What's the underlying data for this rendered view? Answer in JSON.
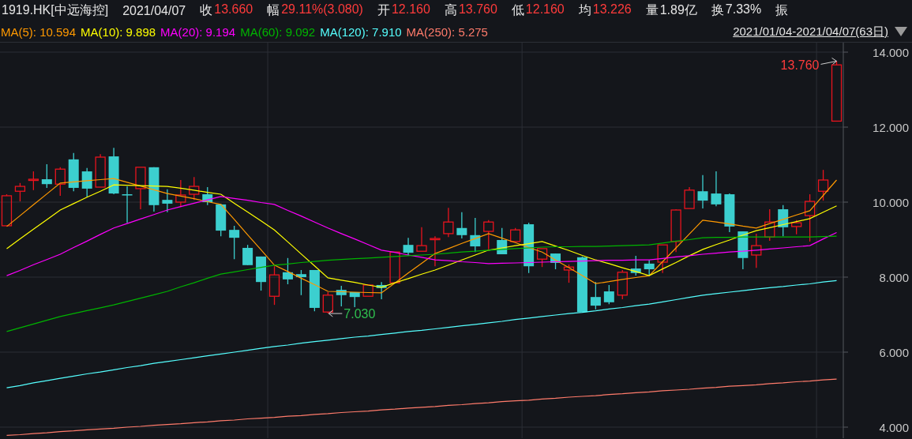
{
  "header": {
    "symbol": "1919.HK[中远海控]",
    "date": "2021/04/07",
    "quotes": [
      {
        "label": "收",
        "value": "13.660",
        "color": "#ff3b3b"
      },
      {
        "label": "幅",
        "value": "29.11%(3.080)",
        "color": "#ff3b3b"
      },
      {
        "label": "开",
        "value": "12.160",
        "color": "#ff3b3b"
      },
      {
        "label": "高",
        "value": "13.760",
        "color": "#ff3b3b"
      },
      {
        "label": "低",
        "value": "12.160",
        "color": "#ff3b3b"
      },
      {
        "label": "均",
        "value": "13.226",
        "color": "#ff3b3b"
      },
      {
        "label": "量",
        "value": "1.89亿",
        "color": "#e6e6e6"
      },
      {
        "label": "换",
        "value": "7.33%",
        "color": "#e6e6e6"
      },
      {
        "label": "振"
      }
    ]
  },
  "legend": {
    "values": [
      ": 10.594",
      ": 9.898",
      ": 9.194",
      ": 9.092",
      ": 7.910",
      ": 5.275"
    ],
    "range": "2021/01/04-2021/04/07(63日)"
  },
  "chart": {
    "high_label": "13.760",
    "low_label": "7.030",
    "chart_data": {
      "type": "candlestick",
      "ylim": [
        3.705,
        14.253
      ],
      "grid": true,
      "yticks": [
        {
          "value": 14,
          "label": "14.000"
        },
        {
          "value": 12,
          "label": "12.000"
        },
        {
          "value": 10,
          "label": "10.000"
        },
        {
          "value": 8,
          "label": "8.000"
        },
        {
          "value": 6,
          "label": "6.000"
        },
        {
          "value": 4,
          "label": "4.000"
        }
      ],
      "categories": [
        null,
        null,
        null,
        null,
        null,
        null,
        null,
        null,
        null,
        null,
        null,
        null,
        null,
        null,
        null,
        null,
        null,
        null,
        null,
        null,
        null,
        null,
        null,
        null,
        null,
        null,
        null,
        null,
        null,
        null,
        null,
        null,
        null,
        null,
        null,
        null,
        null,
        null,
        null,
        null,
        null,
        null,
        null,
        null,
        null,
        null,
        null,
        null,
        null,
        null,
        null,
        null,
        null,
        null,
        null,
        null,
        null,
        null,
        null,
        null,
        null,
        null,
        null
      ],
      "ohlc": [
        [
          9.37,
          10.21,
          9.37,
          10.17
        ],
        [
          10.29,
          10.51,
          10.02,
          10.42
        ],
        [
          10.59,
          10.82,
          10.32,
          10.61
        ],
        [
          10.61,
          11.01,
          10.38,
          10.48
        ],
        [
          10.48,
          10.93,
          10.17,
          10.88
        ],
        [
          11.14,
          11.31,
          10.29,
          10.38
        ],
        [
          10.82,
          10.91,
          10.13,
          10.36
        ],
        [
          10.4,
          11.28,
          10.4,
          11.2
        ],
        [
          11.22,
          11.45,
          10.21,
          10.23
        ],
        [
          10.21,
          10.42,
          9.45,
          10.19
        ],
        [
          10.36,
          10.93,
          9.81,
          10.93
        ],
        [
          10.93,
          10.93,
          9.75,
          9.92
        ],
        [
          10.06,
          10.34,
          9.73,
          9.96
        ],
        [
          10.0,
          10.59,
          9.87,
          10.19
        ],
        [
          10.21,
          10.67,
          10.06,
          10.42
        ],
        [
          10.21,
          10.4,
          9.92,
          10.0
        ],
        [
          9.94,
          9.96,
          9.09,
          9.24
        ],
        [
          9.26,
          9.37,
          8.48,
          9.05
        ],
        [
          8.78,
          8.86,
          8.32,
          8.32
        ],
        [
          8.55,
          8.55,
          7.64,
          7.87
        ],
        [
          7.49,
          8.29,
          7.26,
          8.06
        ],
        [
          8.13,
          8.51,
          7.81,
          7.94
        ],
        [
          8.08,
          8.19,
          7.52,
          8.0
        ],
        [
          8.19,
          8.19,
          7.09,
          7.18
        ],
        [
          7.07,
          7.6,
          7.03,
          7.52
        ],
        [
          7.66,
          7.77,
          7.22,
          7.52
        ],
        [
          7.6,
          7.6,
          7.2,
          7.47
        ],
        [
          7.49,
          7.81,
          7.49,
          7.79
        ],
        [
          7.79,
          7.87,
          7.41,
          7.71
        ],
        [
          7.85,
          8.67,
          7.85,
          8.67
        ],
        [
          8.86,
          9.05,
          8.57,
          8.65
        ],
        [
          8.69,
          9.33,
          8.69,
          8.84
        ],
        [
          9.01,
          9.09,
          8.29,
          9.03
        ],
        [
          9.16,
          9.85,
          9.07,
          9.47
        ],
        [
          9.31,
          9.73,
          9.03,
          9.12
        ],
        [
          9.12,
          9.58,
          8.67,
          8.82
        ],
        [
          9.22,
          9.52,
          8.74,
          9.47
        ],
        [
          8.99,
          9.31,
          8.61,
          8.61
        ],
        [
          8.95,
          9.31,
          8.95,
          9.26
        ],
        [
          9.41,
          9.45,
          8.11,
          8.29
        ],
        [
          8.48,
          8.76,
          8.27,
          8.76
        ],
        [
          8.63,
          8.63,
          8.21,
          8.38
        ],
        [
          8.19,
          8.34,
          7.85,
          8.27
        ],
        [
          8.53,
          8.55,
          7.07,
          7.07
        ],
        [
          7.47,
          7.87,
          7.14,
          7.24
        ],
        [
          7.62,
          7.79,
          7.28,
          7.33
        ],
        [
          7.52,
          8.19,
          7.41,
          8.13
        ],
        [
          8.23,
          8.57,
          8.04,
          8.11
        ],
        [
          8.36,
          8.46,
          8.06,
          8.21
        ],
        [
          8.4,
          8.86,
          8.11,
          8.86
        ],
        [
          8.95,
          9.81,
          8.67,
          9.79
        ],
        [
          9.83,
          10.4,
          9.83,
          10.32
        ],
        [
          10.29,
          10.72,
          9.83,
          10.04
        ],
        [
          10.23,
          10.82,
          9.89,
          9.94
        ],
        [
          10.21,
          10.23,
          9.2,
          9.35
        ],
        [
          9.22,
          9.22,
          8.21,
          8.51
        ],
        [
          8.59,
          9.16,
          8.25,
          8.84
        ],
        [
          9.07,
          9.81,
          8.97,
          9.47
        ],
        [
          9.81,
          9.92,
          9.09,
          9.33
        ],
        [
          9.35,
          9.52,
          9.14,
          9.45
        ],
        [
          9.64,
          10.21,
          8.95,
          10.02
        ],
        [
          10.29,
          10.86,
          10.04,
          10.59
        ],
        [
          12.16,
          13.76,
          12.16,
          13.66
        ]
      ],
      "series": [
        {
          "name": "MA(5)",
          "type": "line",
          "color": "#ff9900",
          "values": [
            9.35,
            9.64,
            9.93,
            10.22,
            10.51,
            10.54,
            10.57,
            10.6,
            10.63,
            10.53,
            10.43,
            10.33,
            10.23,
            10.16,
            10.09,
            10.01,
            9.94,
            9.54,
            9.13,
            8.73,
            8.32,
            8.15,
            7.97,
            7.8,
            7.62,
            7.61,
            7.6,
            7.59,
            7.58,
            7.84,
            8.11,
            8.37,
            8.63,
            8.76,
            8.9,
            9.03,
            9.16,
            9.04,
            8.92,
            8.79,
            8.67,
            8.46,
            8.25,
            8.04,
            7.83,
            7.88,
            7.94,
            7.99,
            8.04,
            8.41,
            8.78,
            9.15,
            9.52,
            9.47,
            9.42,
            9.36,
            9.31,
            9.43,
            9.54,
            9.66,
            9.77,
            10.18,
            10.59
          ]
        },
        {
          "name": "MA(10)",
          "type": "line",
          "color": "#ffff00",
          "values": [
            8.76,
            9.02,
            9.28,
            9.53,
            9.79,
            9.96,
            10.13,
            10.29,
            10.46,
            10.45,
            10.44,
            10.43,
            10.42,
            10.37,
            10.32,
            10.26,
            10.21,
            9.97,
            9.74,
            9.5,
            9.26,
            8.94,
            8.62,
            8.3,
            7.98,
            7.92,
            7.86,
            7.79,
            7.73,
            7.85,
            7.96,
            8.08,
            8.19,
            8.32,
            8.46,
            8.59,
            8.72,
            8.78,
            8.84,
            8.89,
            8.95,
            8.83,
            8.71,
            8.58,
            8.46,
            8.36,
            8.25,
            8.15,
            8.04,
            8.22,
            8.39,
            8.57,
            8.74,
            8.87,
            8.99,
            9.12,
            9.24,
            9.32,
            9.4,
            9.48,
            9.56,
            9.73,
            9.9
          ]
        },
        {
          "name": "MA(20)",
          "type": "line",
          "color": "#ff00ff",
          "values": [
            8.04,
            8.18,
            8.33,
            8.47,
            8.61,
            8.79,
            8.96,
            9.14,
            9.31,
            9.43,
            9.55,
            9.67,
            9.79,
            9.88,
            9.97,
            10.06,
            10.15,
            10.1,
            10.05,
            9.99,
            9.94,
            9.78,
            9.63,
            9.47,
            9.31,
            9.16,
            9.02,
            8.87,
            8.72,
            8.66,
            8.59,
            8.53,
            8.46,
            8.44,
            8.41,
            8.39,
            8.36,
            8.37,
            8.38,
            8.39,
            8.4,
            8.41,
            8.42,
            8.43,
            8.44,
            8.45,
            8.45,
            8.46,
            8.46,
            8.5,
            8.54,
            8.57,
            8.61,
            8.64,
            8.67,
            8.69,
            8.72,
            8.75,
            8.78,
            8.81,
            8.84,
            9.02,
            9.19
          ]
        },
        {
          "name": "MA(60)",
          "type": "line",
          "color": "#00b400",
          "values": [
            6.55,
            6.65,
            6.75,
            6.85,
            6.95,
            7.03,
            7.11,
            7.18,
            7.26,
            7.35,
            7.44,
            7.53,
            7.62,
            7.74,
            7.85,
            7.97,
            8.08,
            8.14,
            8.2,
            8.26,
            8.32,
            8.35,
            8.39,
            8.42,
            8.45,
            8.47,
            8.49,
            8.51,
            8.53,
            8.55,
            8.57,
            8.59,
            8.61,
            8.64,
            8.67,
            8.69,
            8.72,
            8.74,
            8.76,
            8.78,
            8.8,
            8.81,
            8.81,
            8.82,
            8.82,
            8.83,
            8.84,
            8.85,
            8.86,
            8.91,
            8.96,
            9.0,
            9.05,
            9.06,
            9.06,
            9.07,
            9.07,
            9.07,
            9.07,
            9.07,
            9.07,
            9.08,
            9.09
          ]
        },
        {
          "name": "MA(120)",
          "type": "line",
          "color": "#55ffff",
          "values": [
            5.05,
            5.11,
            5.18,
            5.24,
            5.3,
            5.36,
            5.42,
            5.47,
            5.53,
            5.59,
            5.64,
            5.7,
            5.75,
            5.8,
            5.85,
            5.9,
            5.95,
            6.0,
            6.05,
            6.1,
            6.15,
            6.19,
            6.24,
            6.28,
            6.32,
            6.36,
            6.4,
            6.43,
            6.47,
            6.51,
            6.55,
            6.58,
            6.62,
            6.66,
            6.7,
            6.74,
            6.78,
            6.82,
            6.87,
            6.91,
            6.95,
            6.99,
            7.03,
            7.06,
            7.1,
            7.15,
            7.19,
            7.24,
            7.28,
            7.34,
            7.4,
            7.46,
            7.52,
            7.56,
            7.6,
            7.64,
            7.68,
            7.72,
            7.75,
            7.79,
            7.82,
            7.87,
            7.91
          ]
        },
        {
          "name": "MA(250)",
          "type": "line",
          "color": "#ff7b6b",
          "values": [
            3.78,
            3.8,
            3.83,
            3.85,
            3.88,
            3.9,
            3.93,
            3.95,
            3.97,
            4.0,
            4.02,
            4.05,
            4.07,
            4.09,
            4.12,
            4.14,
            4.17,
            4.19,
            4.22,
            4.24,
            4.26,
            4.29,
            4.31,
            4.34,
            4.36,
            4.39,
            4.41,
            4.43,
            4.46,
            4.48,
            4.51,
            4.53,
            4.55,
            4.58,
            4.6,
            4.63,
            4.65,
            4.68,
            4.7,
            4.72,
            4.75,
            4.77,
            4.8,
            4.82,
            4.84,
            4.87,
            4.89,
            4.92,
            4.94,
            4.97,
            4.99,
            5.01,
            5.04,
            5.06,
            5.09,
            5.11,
            5.13,
            5.16,
            5.18,
            5.21,
            5.23,
            5.26,
            5.28
          ]
        }
      ]
    }
  }
}
